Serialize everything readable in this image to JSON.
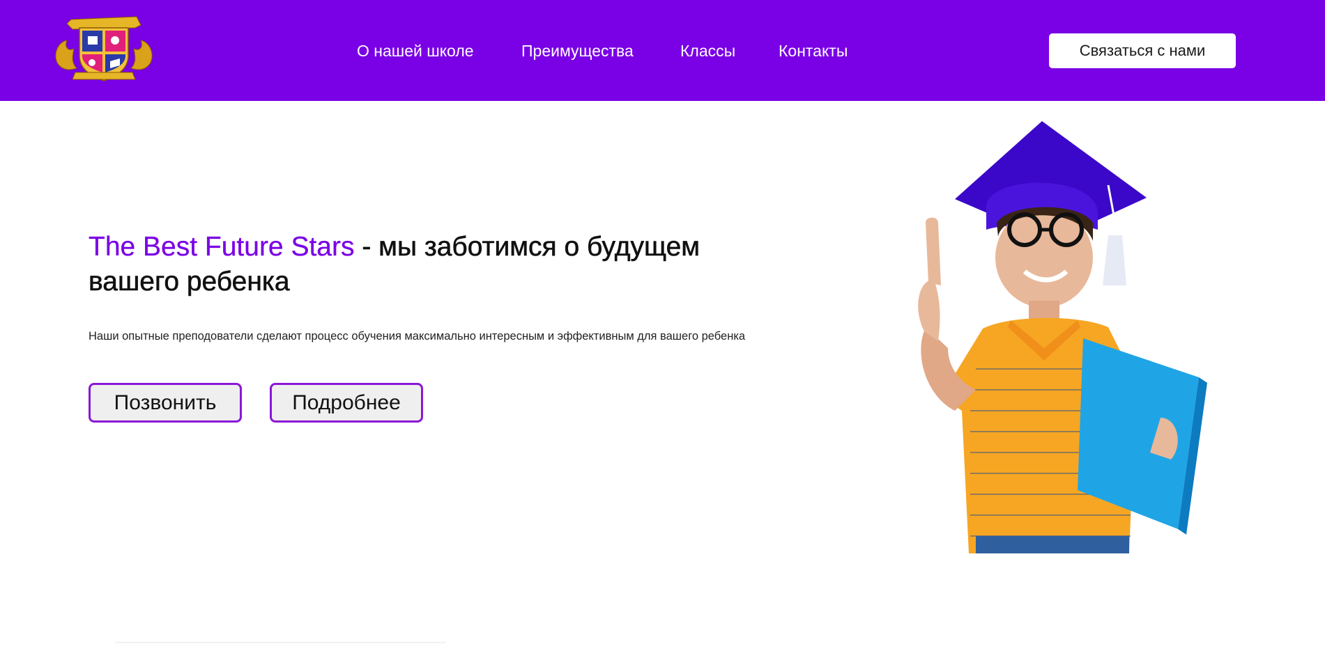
{
  "header": {
    "bg_color": "#7a00e6",
    "logo_icon": "school-crest-logo",
    "nav": [
      {
        "label": "О нашей школе"
      },
      {
        "label": "Преимущества"
      },
      {
        "label": "Классы"
      },
      {
        "label": "Контакты"
      }
    ],
    "contact_button": "Связаться с нами"
  },
  "hero": {
    "title_brand": "The Best Future Stars",
    "title_rest": " - мы заботимся о будущем вашего ребенка",
    "subtitle": "Наши опытные преподователи сделают процесс обучения максимально интересным и эффективным для вашего ребенка",
    "buttons": {
      "call": "Позвонить",
      "more": "Подробнее"
    },
    "image_icon": "boy-graduate-illustration",
    "accent_color": "#7a00e6"
  }
}
